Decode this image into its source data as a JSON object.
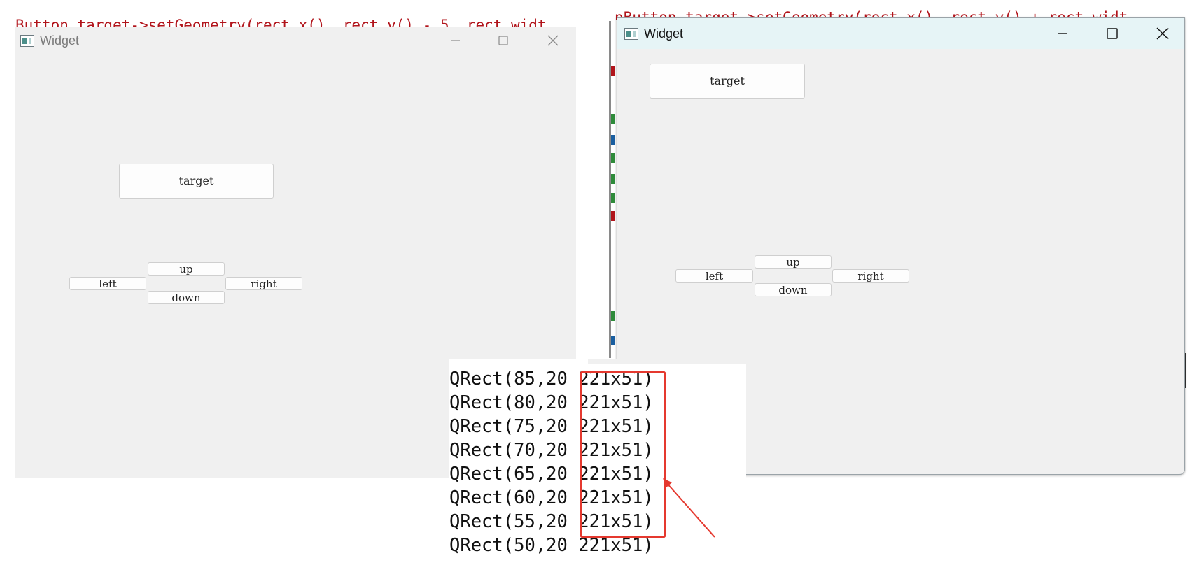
{
  "background_code": {
    "left_fragment": "Button target->setGeometry(rect.x(), rect.y() - 5, rect.widt",
    "right_fragment": "pButton target->setGeometry(rect.x(), rect.y() + rect.widt"
  },
  "window_left": {
    "title": "Widget",
    "minimize_glyph": "—",
    "maximize_glyph": "☐",
    "close_glyph": "✕",
    "buttons": {
      "target": "target",
      "up": "up",
      "left": "left",
      "right": "right",
      "down": "down"
    }
  },
  "window_right": {
    "title": "Widget",
    "minimize_glyph": "—",
    "maximize_glyph": "☐",
    "close_glyph": "✕",
    "buttons": {
      "target": "target",
      "up": "up",
      "left": "left",
      "right": "right",
      "down": "down"
    }
  },
  "console_output": {
    "lines": [
      "QRect(85,20 221x51)",
      "QRect(80,20 221x51)",
      "QRect(75,20 221x51)",
      "QRect(70,20 221x51)",
      "QRect(65,20 221x51)",
      "QRect(60,20 221x51)",
      "QRect(55,20 221x51)",
      "QRect(50,20 221x51)"
    ]
  },
  "colors": {
    "titlebar_left": "#f0f0f0",
    "titlebar_right": "#e6f4f6",
    "window_body": "#f0f0f0",
    "annotation_red": "#e5392f",
    "code_red": "#b1141b",
    "code_blue": "#1a5fa0",
    "code_green": "#2e8b3a"
  }
}
